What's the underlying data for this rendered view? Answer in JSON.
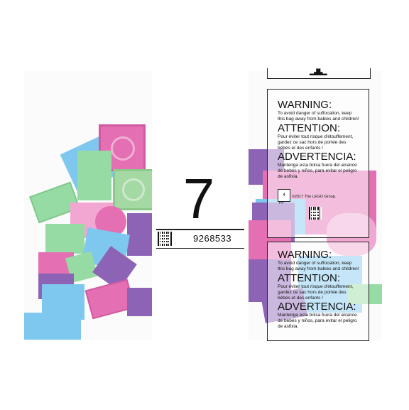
{
  "number": "7",
  "code": "9268533",
  "warning_block": {
    "warning_title": "WARNING:",
    "warning_text": "To avoid danger of suffocation, keep this bag away from babies and children!",
    "attention_title": "ATTENTION:",
    "attention_text": "Pour éviter tout risque d'étouffement, gardez ce sac hors de portée des bébés et des enfants !",
    "advertencia_title": "ADVERTENCIA:",
    "advertencia_text": "Mantenga esta bolsa fuera del alcance de bebés y niños, para evitar el peligro de asfixia."
  },
  "copyright": "©2017 The LEGO Group.",
  "recycle_code": "4",
  "recycle_label": "PP",
  "colors": {
    "pink": "#e46fb3",
    "light_blue": "#7ec8f0",
    "green": "#96dba3",
    "purple": "#8c63b5",
    "light_pink": "#f2a7d3"
  }
}
